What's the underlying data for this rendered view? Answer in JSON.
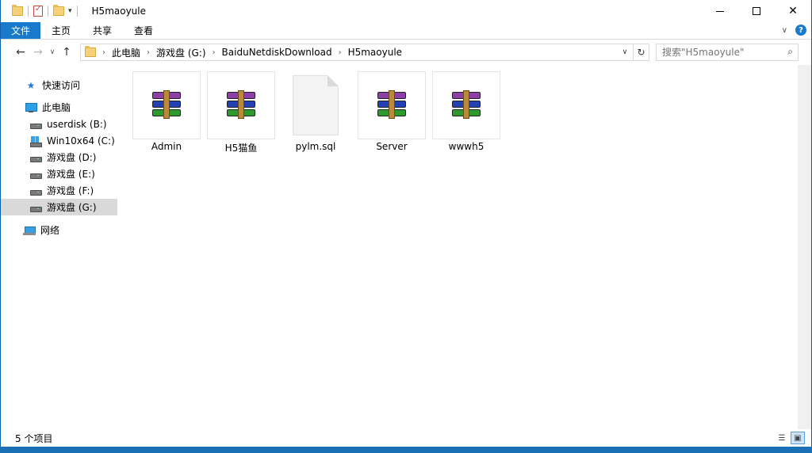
{
  "window": {
    "title": "H5maoyule"
  },
  "ribbon": {
    "tabs": [
      "文件",
      "主页",
      "共享",
      "查看"
    ]
  },
  "address": {
    "crumbs": [
      "此电脑",
      "游戏盘 (G:)",
      "BaiduNetdiskDownload",
      "H5maoyule"
    ]
  },
  "search": {
    "placeholder": "搜索\"H5maoyule\""
  },
  "nav": {
    "quick_access": "快速访问",
    "this_pc": "此电脑",
    "drives": [
      "userdisk (B:)",
      "Win10x64 (C:)",
      "游戏盘 (D:)",
      "游戏盘 (E:)",
      "游戏盘 (F:)",
      "游戏盘 (G:)"
    ],
    "network": "网络"
  },
  "files": [
    {
      "name": "Admin",
      "type": "rar-archive-icon"
    },
    {
      "name": "H5猫鱼",
      "type": "rar-archive-icon"
    },
    {
      "name": "pylm.sql",
      "type": "document-icon"
    },
    {
      "name": "Server",
      "type": "rar-archive-icon"
    },
    {
      "name": "wwwh5",
      "type": "rar-archive-icon"
    }
  ],
  "status": {
    "item_count": "5 个项目"
  }
}
